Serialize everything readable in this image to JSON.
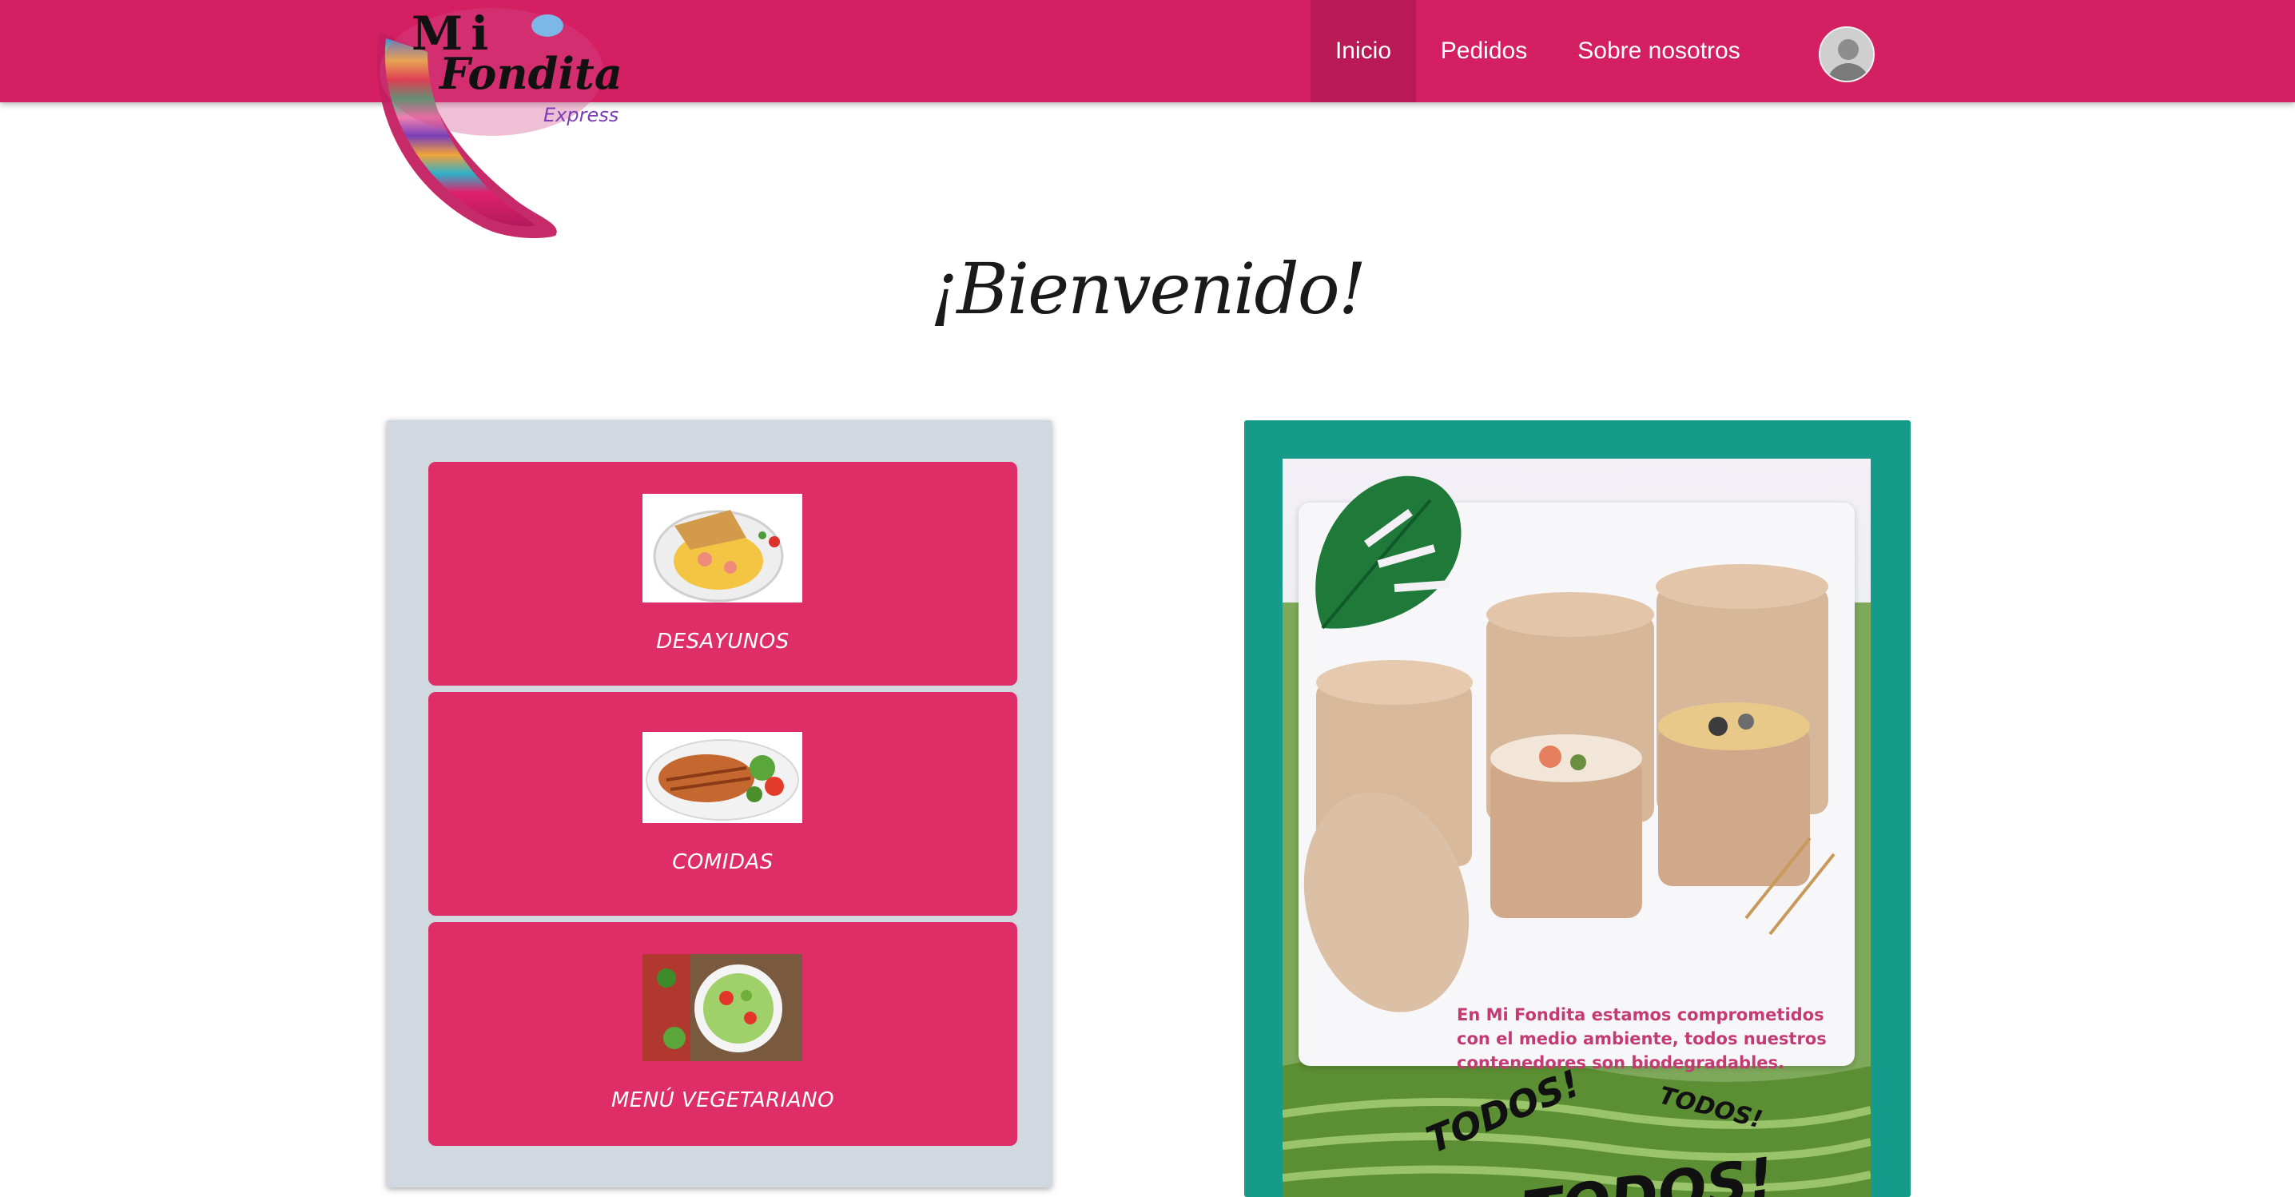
{
  "brand": {
    "logo_text_line1": "Mi",
    "logo_text_line2": "Fondita",
    "logo_text_line3": "Express",
    "primary_color": "#d41f63",
    "active_nav_color": "#b91a56"
  },
  "nav": {
    "items": [
      {
        "label": "Inicio",
        "active": true
      },
      {
        "label": "Pedidos",
        "active": false
      },
      {
        "label": "Sobre nosotros",
        "active": false
      }
    ],
    "avatar_icon": "user-avatar-icon"
  },
  "page": {
    "welcome": "¡Bienvenido!"
  },
  "menu": {
    "panel_color": "#d1d8df",
    "card_color": "#df2e67",
    "items": [
      {
        "label": "DESAYUNOS",
        "image": "breakfast-plate-photo"
      },
      {
        "label": "COMIDAS",
        "image": "grilled-chicken-salad-photo"
      },
      {
        "label": "MENÚ VEGETARIANO",
        "image": "vegetable-salad-photo"
      }
    ]
  },
  "promo": {
    "panel_color": "#169a8a",
    "text": "En Mi Fondita estamos comprometidos con el medio ambiente, todos nuestros contenedores son biodegradables.",
    "burst_1": "TODOS!",
    "burst_2": "TODOS!",
    "burst_3": "TODOS!"
  }
}
